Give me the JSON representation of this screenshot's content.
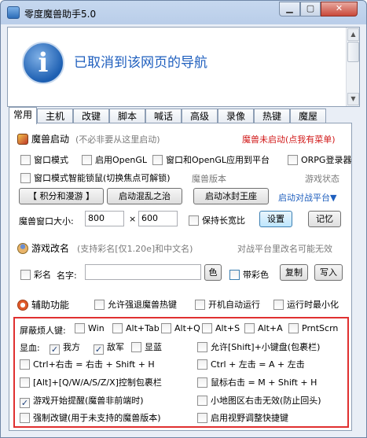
{
  "window": {
    "title": "零度魔兽助手5.0"
  },
  "browser": {
    "message": "已取消到该网页的导航"
  },
  "tabs": [
    "常用",
    "主机",
    "改键",
    "脚本",
    "喊话",
    "高级",
    "录像",
    "热键",
    "魔屋"
  ],
  "launch": {
    "heading": "魔兽启动",
    "hint": "(不必非要从这里启动)",
    "status": "魔兽未启动(点我有菜单)",
    "cb_window_mode": "窗口模式",
    "cb_opengl": "启用OpenGL",
    "cb_window_opengl_platform": "窗口和OpenGL应用到平台",
    "cb_orpg": "ORPG登录器",
    "cb_smart_lock": "窗口模式智能锁鼠(切换焦点可解锁)",
    "version_label": "魔兽版本",
    "game_state_label": "游戏状态",
    "btn_points": "【 积分和漫游 】",
    "btn_chaos": "启动混乱之治",
    "btn_frozen": "启动冰封王座",
    "platform_link": "启动对战平台▼",
    "size_label": "魔兽窗口大小:",
    "width": "800",
    "times": "×",
    "height": "600",
    "cb_keep_ratio": "保持长宽比",
    "btn_set": "设置",
    "btn_remember": "记忆"
  },
  "rename": {
    "heading": "游戏改名",
    "hint": "(支持彩名[仅1.20e]和中文名)",
    "note": "对战平台里改名可能无效",
    "cb_color_name": "彩名",
    "name_label": "名字:",
    "btn_color": "色",
    "cb_with_color": "带彩色",
    "btn_copy": "复制",
    "btn_write": "写入"
  },
  "assist": {
    "heading": "辅助功能",
    "cb_allow_force_exit": "允许强退魔兽热键",
    "cb_autostart": "开机自动运行",
    "cb_minimize": "运行时最小化"
  },
  "hotkeys": {
    "block_label": "屏蔽烦人键:",
    "block_keys": [
      "Win",
      "Alt+Tab",
      "Alt+Q",
      "Alt+S",
      "Alt+A",
      "PrntScrn"
    ],
    "hp_label": "显血:",
    "cb_self": "我方",
    "cb_enemy": "敌军",
    "cb_neutral": "显蓝",
    "cb_shift_numpad": "允许[Shift]+小键盘(包裹栏)",
    "cb_ctrl_right": "Ctrl+右击 = 右击 + Shift + H",
    "cb_ctrl_left": "Ctrl + 左击 = A + 左击",
    "cb_alt_wasd": "[Alt]+[Q/W/A/S/Z/X]控制包裹栏",
    "cb_wheel": "鼠标右击 = M + Shift + H",
    "cb_game_start_alert": "游戏开始提醒(魔兽非前端时)",
    "cb_minimap": "小地图区右击无效(防止回头)",
    "cb_force_keychange": "强制改键(用于未支持的魔兽版本)",
    "cb_view_hotkey": "启用视野调整快捷键"
  }
}
